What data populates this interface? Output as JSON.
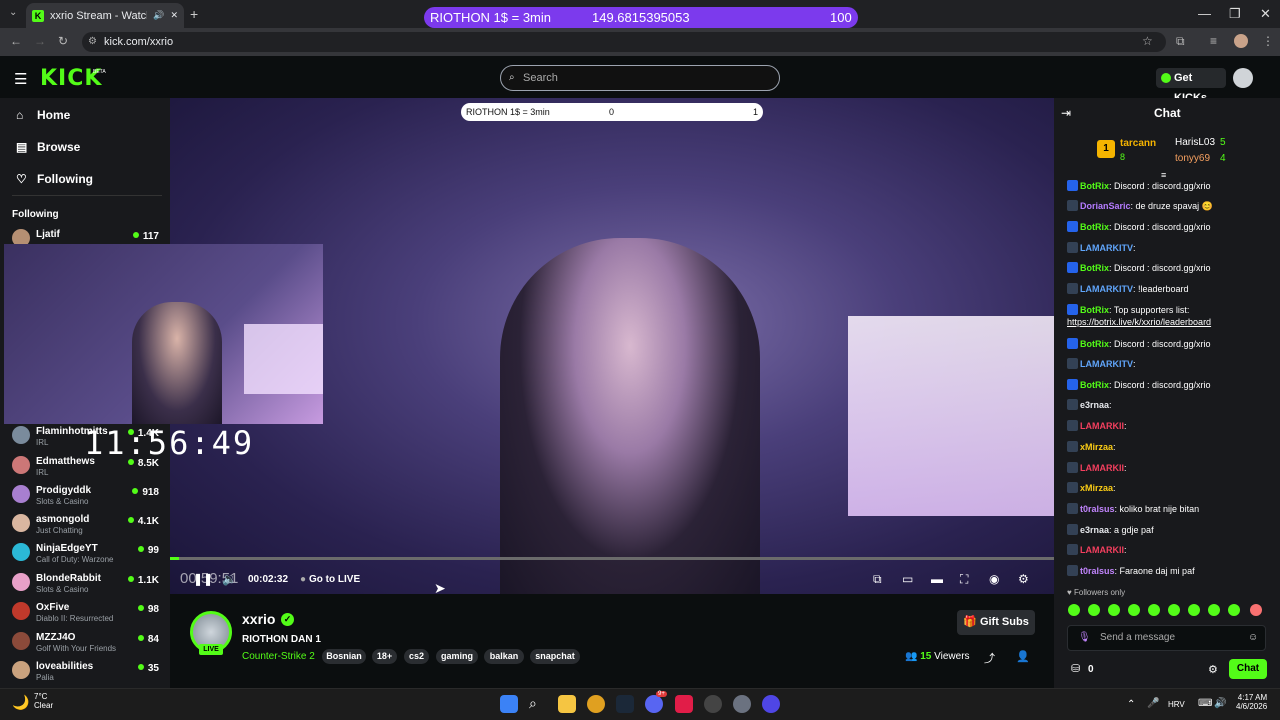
{
  "browser": {
    "tab_title": "xxrio Stream - Watch Live o",
    "url": "kick.com/xxrio",
    "tab_close": "✕",
    "new_tab": "+"
  },
  "banner": {
    "label": "RIOTHON 1$ = 3min",
    "value": "149.6815395053",
    "count": "100"
  },
  "header": {
    "logo": "KICK",
    "beta": "BETA",
    "search_placeholder": "Search",
    "get_kicks": "Get KICKs"
  },
  "sidebar": {
    "nav": [
      {
        "label": "Home",
        "icon": "home-icon"
      },
      {
        "label": "Browse",
        "icon": "browse-icon"
      },
      {
        "label": "Following",
        "icon": "heart-icon"
      }
    ],
    "following_heading": "Following",
    "following": [
      {
        "name": "Ljatif",
        "category": "",
        "viewers": "117"
      },
      {
        "name": "Flaminhotmitts",
        "category": "IRL",
        "viewers": "1.4K"
      },
      {
        "name": "Edmatthews",
        "category": "IRL",
        "viewers": "8.5K"
      },
      {
        "name": "Prodigyddk",
        "category": "Slots & Casino",
        "viewers": "918"
      },
      {
        "name": "asmongold",
        "category": "Just Chatting",
        "viewers": "4.1K"
      },
      {
        "name": "NinjaEdgeYT",
        "category": "Call of Duty: Warzone",
        "viewers": "99"
      },
      {
        "name": "BlondeRabbit",
        "category": "Slots & Casino",
        "viewers": "1.1K"
      },
      {
        "name": "OxFive",
        "category": "Diablo II: Resurrected",
        "viewers": "98"
      },
      {
        "name": "MZZJ4O",
        "category": "Golf With Your Friends",
        "viewers": "84"
      },
      {
        "name": "loveabilities",
        "category": "Palia",
        "viewers": "35"
      }
    ]
  },
  "video": {
    "overlay_label": "RIOTHON 1$ = 3min",
    "overlay_value": "0",
    "overlay_count": "1",
    "clock": "11:56:49",
    "elapsed_overlay": "00:59:51",
    "elapsed": "00:02:32",
    "go_live": "Go to LIVE",
    "progress_fraction": 0.01
  },
  "stream": {
    "streamer": "xxrio",
    "live_badge": "LIVE",
    "title": "RIOTHON DAN 1",
    "category": "Counter-Strike 2",
    "tags": [
      "Bosnian",
      "18+",
      "cs2",
      "gaming",
      "balkan",
      "snapchat"
    ],
    "gift_subs": "Gift Subs",
    "viewers_count": "15",
    "viewers_label": "Viewers"
  },
  "chat": {
    "title": "Chat",
    "leaderboard": [
      {
        "rank": "1",
        "name": "tarcann",
        "count": "8"
      },
      {
        "name": "HarisL03",
        "count": "5"
      },
      {
        "name": "tonyy69",
        "count": "4"
      }
    ],
    "messages": [
      {
        "user": "BotRix",
        "text": ": Discord : discord.gg/xrio",
        "color": "#53fc18"
      },
      {
        "user": "DorianSaric",
        "text": ": de druze spavaj 😊",
        "color": "#b57cff"
      },
      {
        "user": "BotRix",
        "text": ": Discord : discord.gg/xrio",
        "color": "#53fc18"
      },
      {
        "user": "LAMARKITV",
        "text": ":",
        "color": "#60a5fa"
      },
      {
        "user": "BotRix",
        "text": ": Discord : discord.gg/xrio",
        "color": "#53fc18"
      },
      {
        "user": "LAMARKITV",
        "text": ": !leaderboard",
        "color": "#60a5fa"
      },
      {
        "user": "BotRix",
        "text": ": Top supporters list:",
        "color": "#53fc18"
      },
      {
        "user": "",
        "text": "https://botrix.live/k/xxrio/leaderboard",
        "color": "#fff"
      },
      {
        "user": "BotRix",
        "text": ": Discord : discord.gg/xrio",
        "color": "#53fc18"
      },
      {
        "user": "LAMARKITV",
        "text": ":",
        "color": "#60a5fa"
      },
      {
        "user": "BotRix",
        "text": ": Discord : discord.gg/xrio",
        "color": "#53fc18"
      },
      {
        "user": "e3rnaa",
        "text": ":",
        "color": "#e5e7eb"
      },
      {
        "user": "LAMARKII",
        "text": ":",
        "color": "#f43f5e"
      },
      {
        "user": "xMirzaa",
        "text": ":",
        "color": "#facc15"
      },
      {
        "user": "LAMARKII",
        "text": ":",
        "color": "#f43f5e"
      },
      {
        "user": "xMirzaa",
        "text": ":",
        "color": "#facc15"
      },
      {
        "user": "t0ralsus",
        "text": ": koliko brat nije bitan",
        "color": "#c084fc"
      },
      {
        "user": "e3rnaa",
        "text": ": a gdje paf",
        "color": "#e5e7eb"
      },
      {
        "user": "LAMARKII",
        "text": ":",
        "color": "#f43f5e"
      },
      {
        "user": "t0ralsus",
        "text": ": Faraone daj mi paf",
        "color": "#c084fc"
      }
    ],
    "followers_only": "Followers only",
    "input_placeholder": "Send a message",
    "points": "0",
    "send_label": "Chat"
  },
  "taskbar": {
    "temp": "7°C",
    "weather": "Clear",
    "lang": "HRV",
    "time": "4:17 AM",
    "date": "4/6/2026",
    "badge": "9+"
  },
  "colors": {
    "accent": "#53fc18",
    "banner": "#7c3aed",
    "background": "#0b0e0f",
    "panel": "#18191c"
  }
}
